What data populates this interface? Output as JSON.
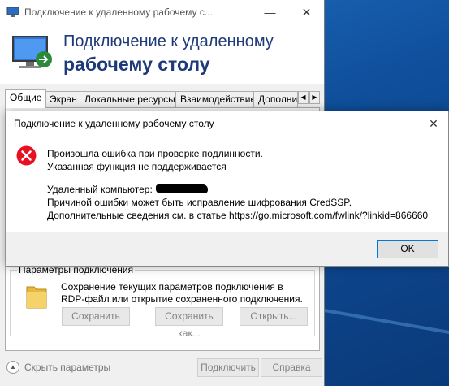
{
  "window": {
    "title": "Подключение к удаленному рабочему с...",
    "header_line1": "Подключение к удаленному",
    "header_line2": "рабочему столу",
    "minimize_glyph": "—",
    "close_glyph": "✕"
  },
  "tabs": [
    {
      "label": "Общие",
      "active": true
    },
    {
      "label": "Экран",
      "active": false
    },
    {
      "label": "Локальные ресурсы",
      "active": false
    },
    {
      "label": "Взаимодействие",
      "active": false
    },
    {
      "label": "Дополнит",
      "active": false
    }
  ],
  "tab_scroll": {
    "left": "◀",
    "right": "▶"
  },
  "connection_settings": {
    "legend": "Параметры подключения",
    "description_line1": "Сохранение текущих параметров подключения в",
    "description_line2": "RDP-файл или открытие сохраненного подключения.",
    "save_button": "Сохранить",
    "save_as_button": "Сохранить как...",
    "open_button": "Открыть..."
  },
  "bottom": {
    "toggle_glyph": "▲",
    "hide_options": "Скрыть параметры",
    "connect_button": "Подключить",
    "help_button": "Справка"
  },
  "dialog": {
    "title": "Подключение к удаленному рабочему столу",
    "close_glyph": "✕",
    "error_line1": "Произошла ошибка при проверке подлинности.",
    "error_line2": "Указанная функция не поддерживается",
    "remote_computer_label": "Удаленный компьютер:",
    "cause_line": "Причиной ошибки может быть исправление шифрования CredSSP.",
    "more_info_line": "Дополнительные сведения см. в статье https://go.microsoft.com/fwlink/?linkid=866660",
    "ok_button": "OK"
  },
  "colors": {
    "header_text": "#1e3a78",
    "error_red": "#e81123",
    "ok_border": "#0078d7",
    "desktop_blue": "#0f4f9c"
  },
  "icons": {
    "app": "remote-desktop-icon",
    "error": "error-icon",
    "folder": "folder-icon"
  }
}
